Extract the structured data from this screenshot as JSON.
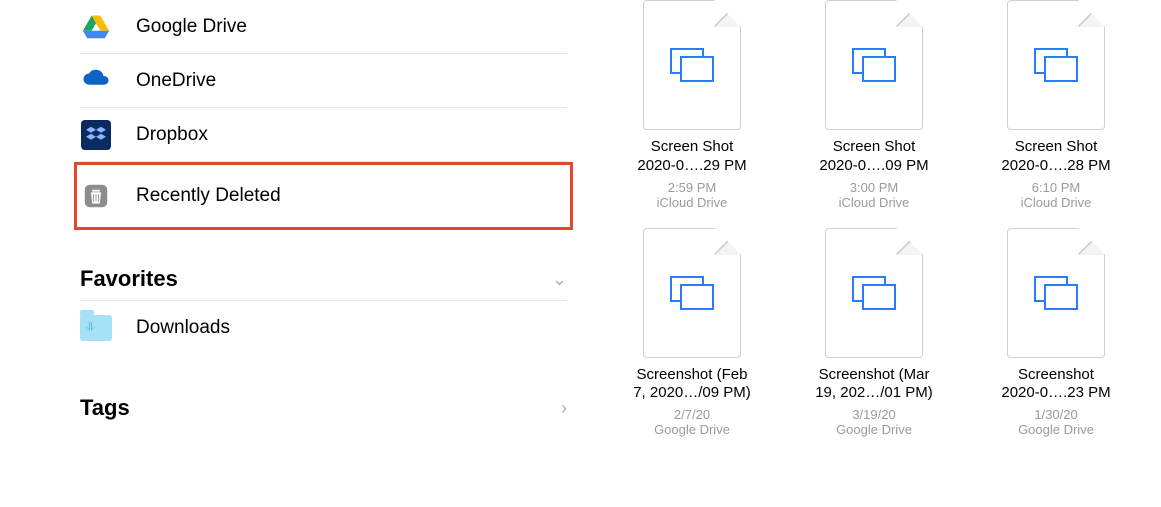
{
  "sidebar": {
    "items": [
      {
        "label": "Google Drive"
      },
      {
        "label": "OneDrive"
      },
      {
        "label": "Dropbox"
      },
      {
        "label": "Recently Deleted"
      }
    ],
    "favorites": {
      "title": "Favorites",
      "items": [
        {
          "label": "Downloads"
        }
      ]
    },
    "tags": {
      "title": "Tags"
    }
  },
  "files": [
    {
      "name1": "Screen Shot",
      "name2": "2020-0….29 PM",
      "time": "2:59 PM",
      "loc": "iCloud Drive"
    },
    {
      "name1": "Screen Shot",
      "name2": "2020-0….09 PM",
      "time": "3:00 PM",
      "loc": "iCloud Drive"
    },
    {
      "name1": "Screen Shot",
      "name2": "2020-0….28 PM",
      "time": "6:10 PM",
      "loc": "iCloud Drive"
    },
    {
      "name1": "Screenshot (Feb",
      "name2": "7, 2020…/09 PM)",
      "time": "2/7/20",
      "loc": "Google Drive"
    },
    {
      "name1": "Screenshot (Mar",
      "name2": "19, 202…/01 PM)",
      "time": "3/19/20",
      "loc": "Google Drive"
    },
    {
      "name1": "Screenshot",
      "name2": "2020-0….23 PM",
      "time": "1/30/20",
      "loc": "Google Drive"
    }
  ]
}
